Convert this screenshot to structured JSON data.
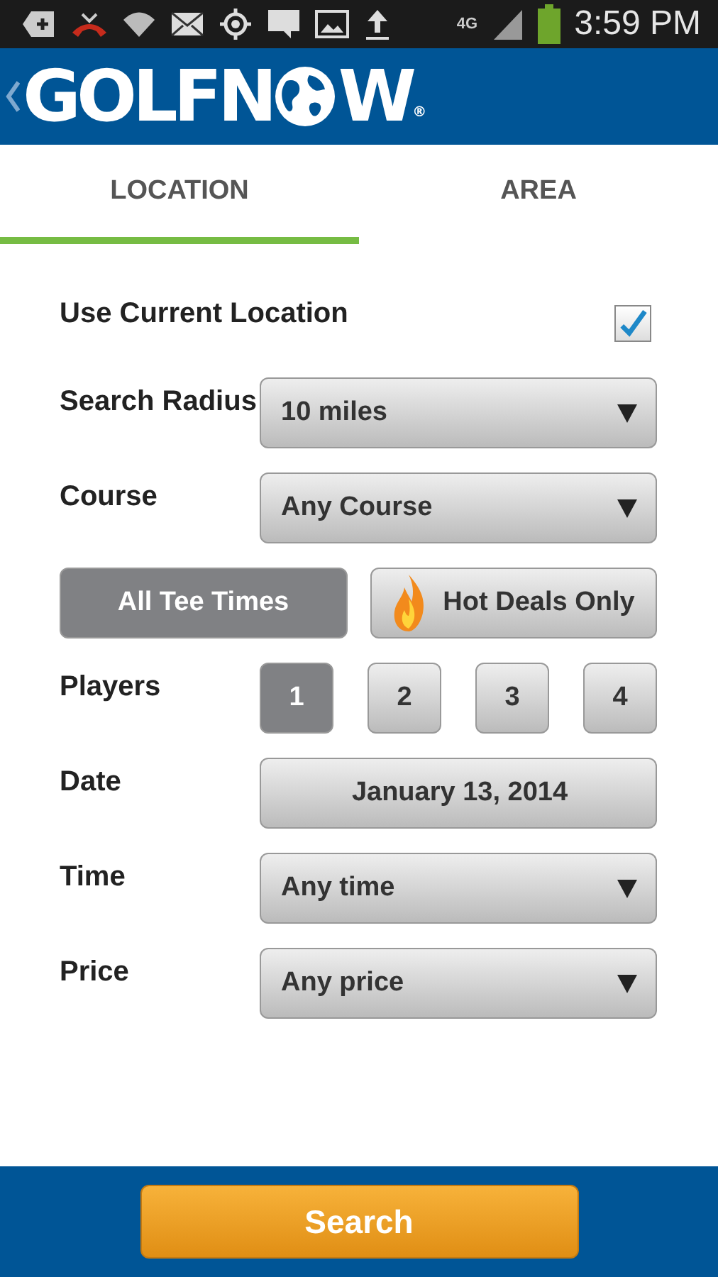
{
  "status_bar": {
    "network": "4G",
    "time": "3:59 PM"
  },
  "header": {
    "logo": {
      "before": "GOLFN",
      "after": "W",
      "mark": "®"
    }
  },
  "tabs": [
    {
      "label": "LOCATION",
      "selected": true
    },
    {
      "label": "AREA",
      "selected": false
    }
  ],
  "form": [
    {
      "kind": "checkbox",
      "label": "Use Current Location",
      "checked": true
    },
    {
      "kind": "dropdown",
      "label": "Search Radius",
      "value": "10 miles"
    },
    {
      "kind": "dropdown",
      "label": "Course",
      "value": "Any Course"
    },
    {
      "kind": "toggle",
      "options": [
        {
          "label": "All Tee Times",
          "selected": true
        },
        {
          "label": "Hot Deals Only",
          "selected": false
        }
      ]
    },
    {
      "kind": "choices",
      "label": "Players",
      "options": [
        {
          "label": "1",
          "selected": true
        },
        {
          "label": "2",
          "selected": false
        },
        {
          "label": "3",
          "selected": false
        },
        {
          "label": "4",
          "selected": false
        }
      ]
    },
    {
      "kind": "date",
      "label": "Date",
      "value": "January 13, 2014"
    },
    {
      "kind": "dropdown",
      "label": "Time",
      "value": "Any time"
    },
    {
      "kind": "dropdown",
      "label": "Price",
      "value": "Any price"
    }
  ],
  "search_button": "Search"
}
